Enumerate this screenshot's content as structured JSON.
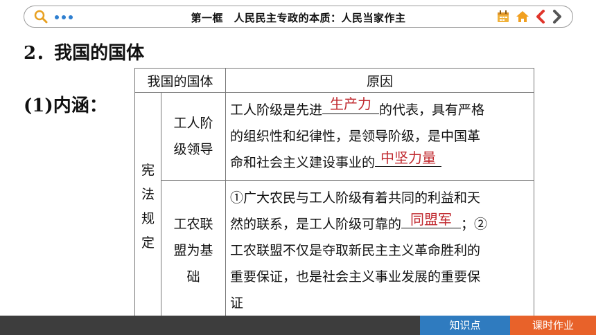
{
  "header": {
    "title": "第一框　人民民主专政的本质：人民当家作主"
  },
  "main": {
    "heading": "2．我国的国体",
    "subheading": "(1)内涵：",
    "table": {
      "col_headers": [
        "我国的国体",
        "原因"
      ],
      "group_label": "宪法规定",
      "group_chars": [
        "宪",
        "法",
        "规",
        "定"
      ],
      "row1": {
        "label_line1": "工人阶",
        "label_line2": "级领导",
        "text_a": "工人阶级是先进",
        "answer_1": "生产力",
        "text_b": "的代表，具有严格",
        "text_c": "的组织性和纪律性，是领导阶级，是中国革",
        "text_d": "命和社会主义建设事业的",
        "answer_2": "中坚力量"
      },
      "row2": {
        "label_line1": "工农联",
        "label_line2": "盟为基",
        "label_line3": "础",
        "text_a": "①广大农民与工人阶级有着共同的利益和天",
        "text_b": "然的联系，是工人阶级可靠的",
        "answer_1": "同盟军",
        "text_c": "；②",
        "text_d": "工农联盟不仅是夺取新民主主义革命胜利的",
        "text_e": "重要保证，也是社会主义事业发展的重要保",
        "text_f": "证"
      }
    }
  },
  "footer": {
    "tab1_label": "知识点",
    "tab2_label": "课时作业"
  },
  "colors": {
    "accent_blue": "#2f7bbf",
    "accent_orange": "#e8622a",
    "answer_red": "#c0282e",
    "footer_bg": "#3d3d3d"
  },
  "icons": [
    "search-icon",
    "more-dots-icon",
    "calendar-icon",
    "home-icon",
    "prev-arrow-icon",
    "next-arrow-icon"
  ]
}
